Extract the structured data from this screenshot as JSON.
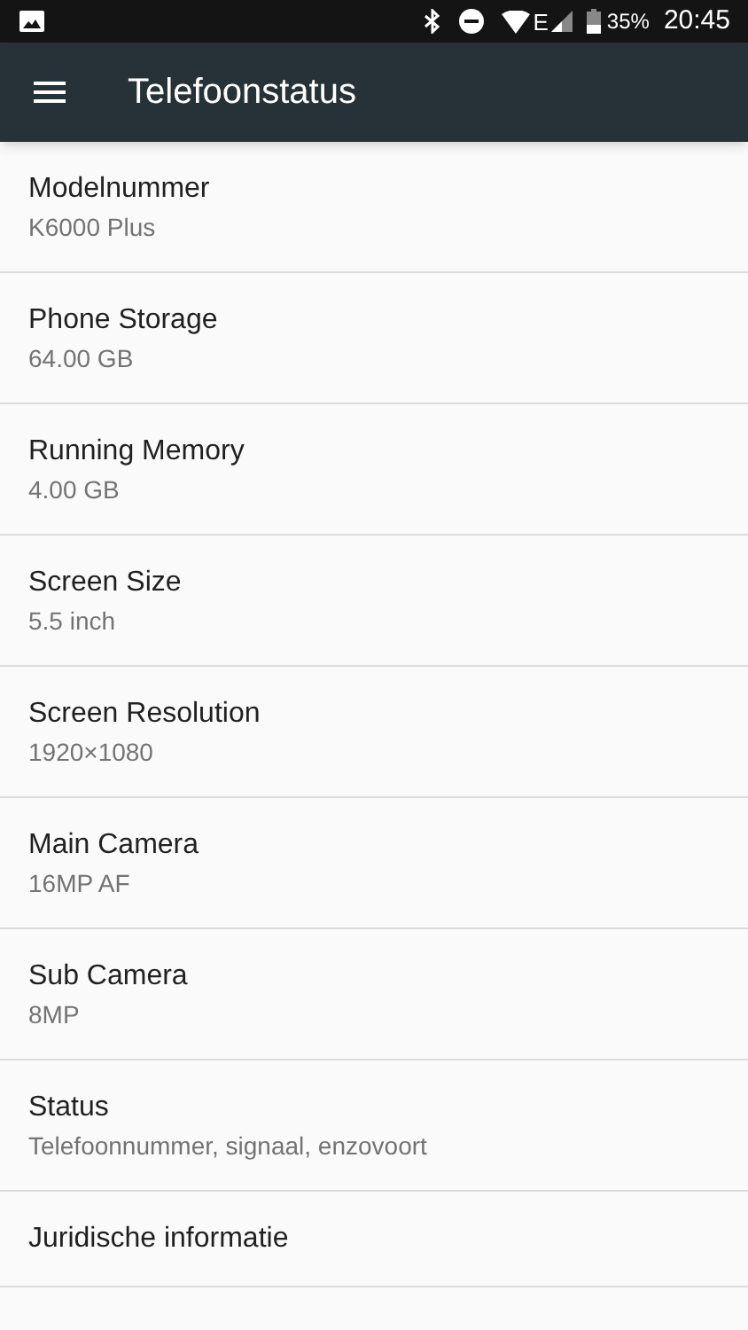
{
  "status_bar": {
    "network_type": "E",
    "battery": "35%",
    "time": "20:45"
  },
  "app_bar": {
    "title": "Telefoonstatus"
  },
  "items": [
    {
      "title": "Modelnummer",
      "summary": "K6000 Plus"
    },
    {
      "title": "Phone Storage",
      "summary": "64.00 GB"
    },
    {
      "title": "Running Memory",
      "summary": "4.00 GB"
    },
    {
      "title": "Screen Size",
      "summary": "5.5 inch"
    },
    {
      "title": "Screen Resolution",
      "summary": "1920×1080"
    },
    {
      "title": "Main Camera",
      "summary": "16MP AF"
    },
    {
      "title": "Sub Camera",
      "summary": "8MP"
    },
    {
      "title": "Status",
      "summary": "Telefoonnummer, signaal, enzovoort"
    },
    {
      "title": "Juridische informatie"
    }
  ]
}
